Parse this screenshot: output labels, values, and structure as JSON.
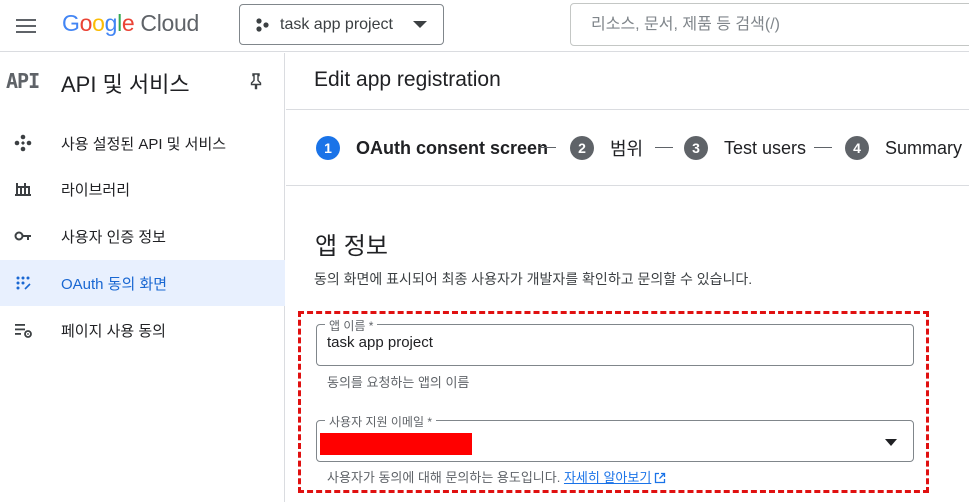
{
  "header": {
    "logo_google": [
      "G",
      "o",
      "o",
      "g",
      "l",
      "e"
    ],
    "logo_cloud": "Cloud",
    "project_name": "task app project",
    "search_placeholder": "리소스, 문서, 제품 등 검색(/)"
  },
  "sidebar": {
    "api_logo": "API",
    "title": "API 및 서비스",
    "items": [
      {
        "label": "사용 설정된 API 및 서비스",
        "icon": "api-diamond-icon",
        "active": false
      },
      {
        "label": "라이브러리",
        "icon": "library-icon",
        "active": false
      },
      {
        "label": "사용자 인증 정보",
        "icon": "key-icon",
        "active": false
      },
      {
        "label": "OAuth 동의 화면",
        "icon": "oauth-dots-icon",
        "active": true
      },
      {
        "label": "페이지 사용 동의",
        "icon": "settings-list-icon",
        "active": false
      }
    ]
  },
  "main": {
    "title": "Edit app registration",
    "steps": [
      {
        "num": "1",
        "label": "OAuth consent screen",
        "current": true
      },
      {
        "num": "2",
        "label": "범위",
        "current": false
      },
      {
        "num": "3",
        "label": "Test users",
        "current": false
      },
      {
        "num": "4",
        "label": "Summary",
        "current": false
      }
    ],
    "section_title": "앱 정보",
    "section_desc": "동의 화면에 표시되어 최종 사용자가 개발자를 확인하고 문의할 수 있습니다.",
    "app_name": {
      "label": "앱 이름 *",
      "value": "task app project",
      "hint": "동의를 요청하는 앱의 이름"
    },
    "support_email": {
      "label": "사용자 지원 이메일 *",
      "hint": "사용자가 동의에 대해 문의하는 용도입니다.",
      "link": "자세히 알아보기"
    }
  },
  "colors": {
    "accent": "#1a73e8",
    "active_bg": "#e8f0fe",
    "highlight": "#e01010",
    "redaction": "#ff0000"
  }
}
